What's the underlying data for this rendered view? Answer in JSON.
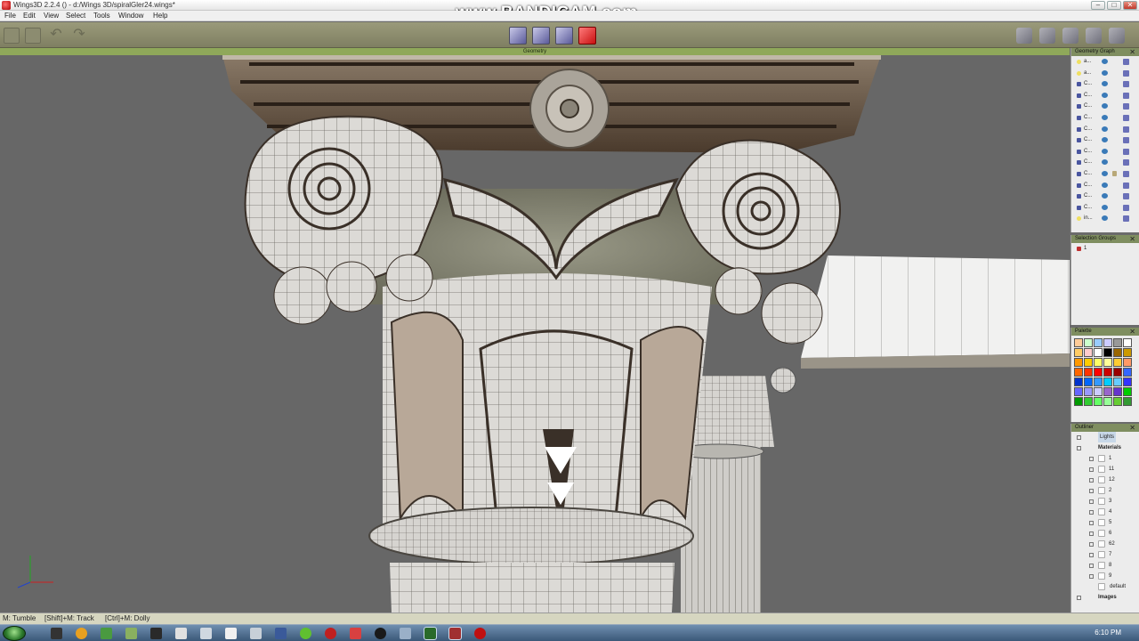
{
  "window": {
    "title": "Wings3D 2.2.4 () - d:/Wings 3D/spiralGler24.wings*",
    "min": "–",
    "max": "□",
    "close": "✕"
  },
  "watermark": "www.BANDICAM.com",
  "menu": [
    "File",
    "Edit",
    "View",
    "Select",
    "Tools",
    "Window",
    "Help"
  ],
  "toolbar": {
    "left_icons": [
      "open-file-icon",
      "save-file-icon",
      "undo-icon",
      "redo-icon"
    ],
    "selection_modes": [
      "vertex-mode-icon",
      "edge-mode-icon",
      "face-mode-icon",
      "body-mode-icon"
    ],
    "active_mode": "body-mode-icon",
    "right_icons": [
      "gear-icon",
      "cube-smooth-icon",
      "cube-wire-icon",
      "texture-icon",
      "person-icon"
    ]
  },
  "viewport": {
    "header": "Geometry"
  },
  "geometry_graph": {
    "title": "Geometry Graph",
    "items": [
      {
        "label": "a...",
        "type": "light"
      },
      {
        "label": "a...",
        "type": "light"
      },
      {
        "label": "C...",
        "type": "object"
      },
      {
        "label": "C...",
        "type": "object"
      },
      {
        "label": "C...",
        "type": "object"
      },
      {
        "label": "C...",
        "type": "object"
      },
      {
        "label": "C...",
        "type": "object"
      },
      {
        "label": "C...",
        "type": "object"
      },
      {
        "label": "C...",
        "type": "object"
      },
      {
        "label": "C...",
        "type": "object"
      },
      {
        "label": "C...",
        "type": "object",
        "locked": true
      },
      {
        "label": "C...",
        "type": "object"
      },
      {
        "label": "C...",
        "type": "object"
      },
      {
        "label": "C...",
        "type": "object"
      },
      {
        "label": "in...",
        "type": "light"
      }
    ]
  },
  "selection_groups": {
    "title": "Selection Groups",
    "items": [
      "1"
    ]
  },
  "palette": {
    "title": "Palette",
    "colors": [
      "#ffcc99",
      "#ccffcc",
      "#99ccff",
      "#ccccff",
      "#999999",
      "#ffffff",
      "#ffcc66",
      "#ffcccc",
      "#ffffff",
      "#000000",
      "#996600",
      "#cc9900",
      "#ff9900",
      "#ffcc00",
      "#ffff66",
      "#ffff99",
      "#ffcc33",
      "#ff9966",
      "#ff6600",
      "#ff3300",
      "#ff0000",
      "#cc0000",
      "#990000",
      "#3366ff",
      "#0033cc",
      "#0066ff",
      "#3399ff",
      "#00ccff",
      "#66ccff",
      "#3333ff",
      "#6666ff",
      "#9999ff",
      "#ccccff",
      "#9966cc",
      "#6633cc",
      "#00cc00",
      "#009900",
      "#33cc33",
      "#66ff66",
      "#99ff99",
      "#66cc33",
      "#339933"
    ]
  },
  "outliner": {
    "title": "Outliner",
    "lights_label": "Lights",
    "materials_label": "Materials",
    "materials": [
      "1",
      "11",
      "12",
      "2",
      "3",
      "4",
      "5",
      "6",
      "62",
      "7",
      "8",
      "9",
      "default"
    ],
    "images_label": "Images"
  },
  "statusbar": {
    "left": "M: Tumble",
    "middle": "[Shift]+M: Track",
    "right": "[Ctrl]+M: Dolly"
  },
  "taskbar": {
    "clock": "6:10 PM"
  }
}
